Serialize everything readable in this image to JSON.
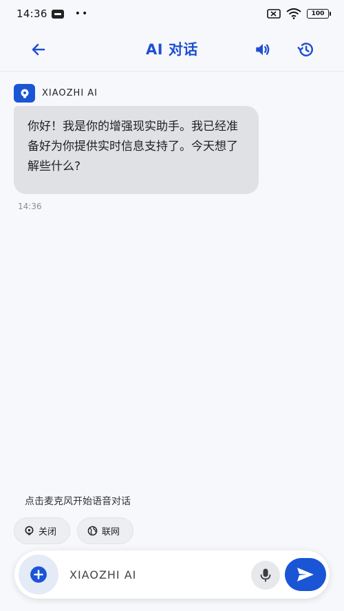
{
  "status_bar": {
    "time": "14:36",
    "dots": "••",
    "battery": "100"
  },
  "header": {
    "title": "AI 对话"
  },
  "chat": {
    "sender_name": "XIAOZHI AI",
    "message_text": "你好！我是你的增强现实助手。我已经准备好为你提供实时信息支持了。今天想了解些什么?",
    "message_time": "14:36"
  },
  "voice_hint": "点击麦克风开始语音对话",
  "chips": {
    "close_label": "关闭",
    "network_label": "联网"
  },
  "input": {
    "placeholder": "XIAOZHI AI",
    "value": ""
  },
  "colors": {
    "accent": "#1a55d6",
    "title": "#1f4fd1",
    "bubble": "#dfe1e5",
    "background": "#f7f8fc"
  }
}
